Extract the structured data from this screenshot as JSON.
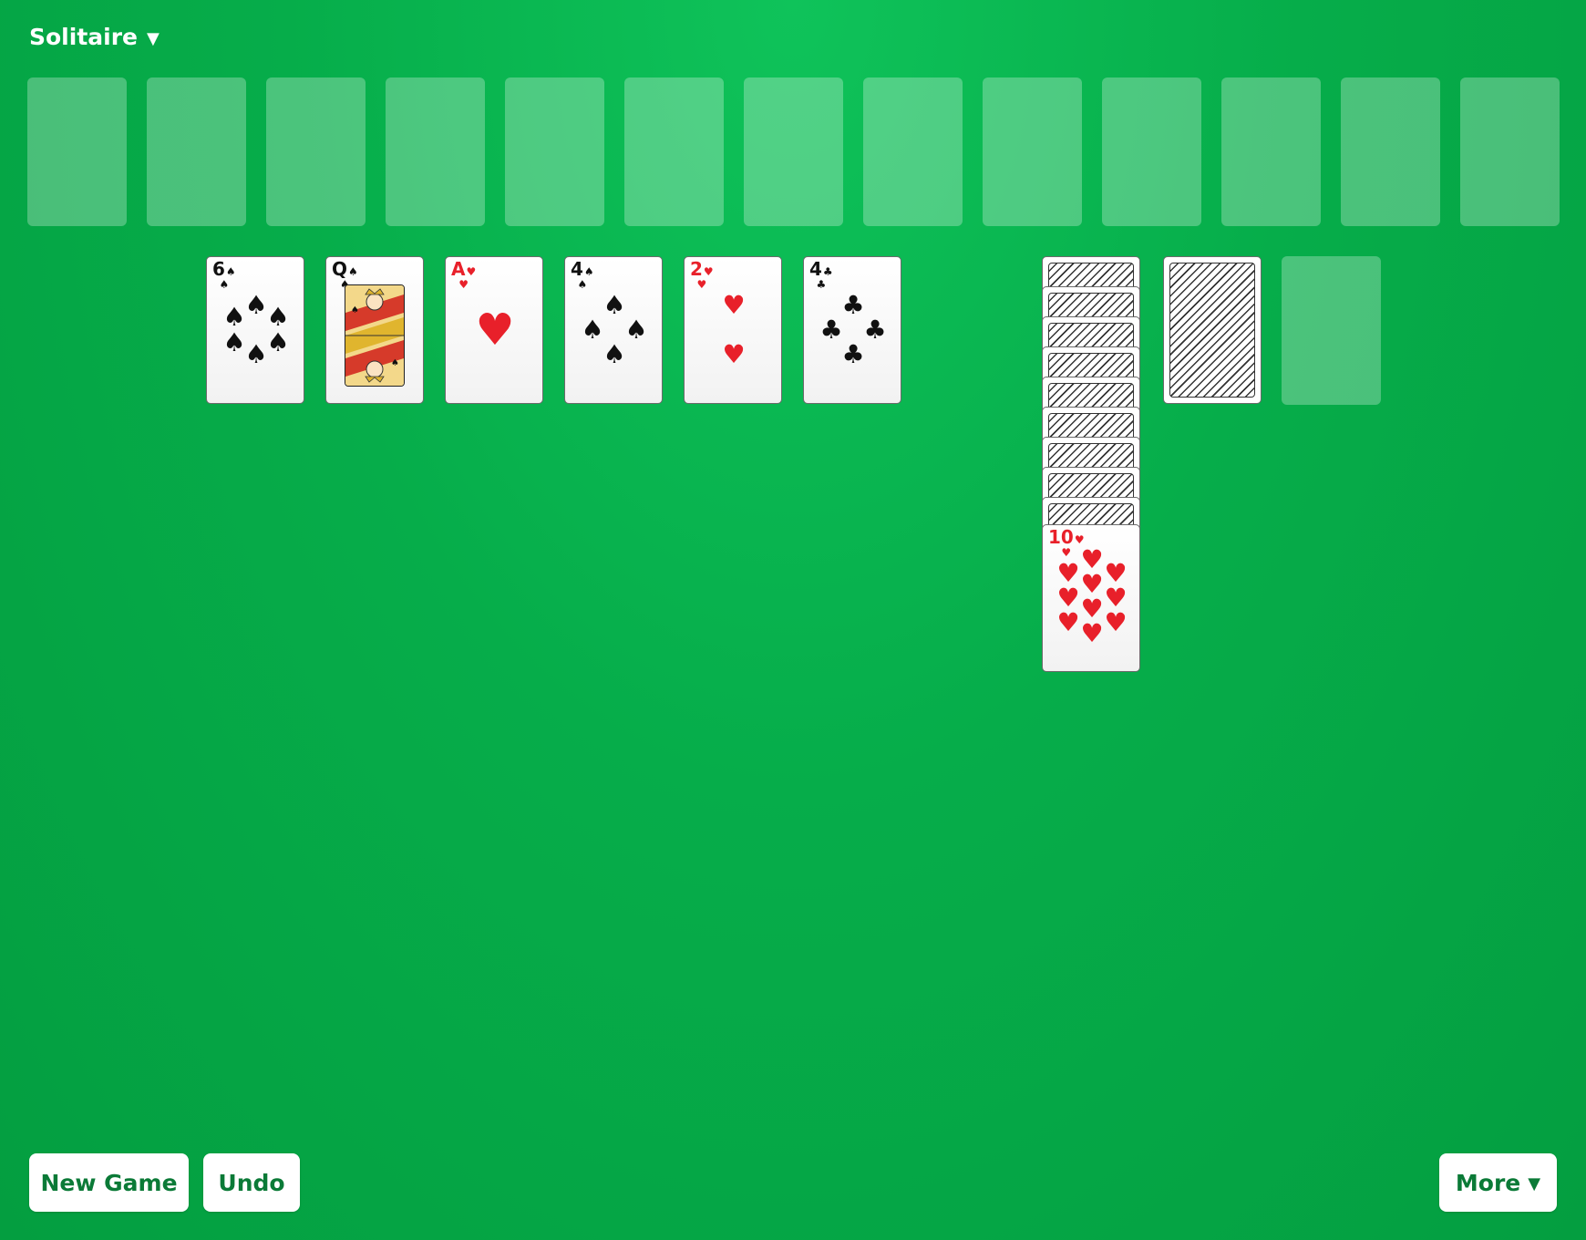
{
  "header": {
    "title": "Solitaire"
  },
  "icons": {
    "dropdown": "caret-down-icon"
  },
  "foundations_count": 13,
  "tableau": [
    {
      "rank": "6",
      "suit": "spades",
      "symbol": "♠",
      "color": "black"
    },
    {
      "rank": "Q",
      "suit": "spades",
      "symbol": "♠",
      "color": "black"
    },
    {
      "rank": "A",
      "suit": "hearts",
      "symbol": "♥",
      "color": "red"
    },
    {
      "rank": "4",
      "suit": "spades",
      "symbol": "♠",
      "color": "black"
    },
    {
      "rank": "2",
      "suit": "hearts",
      "symbol": "♥",
      "color": "red"
    },
    {
      "rank": "4",
      "suit": "clubs",
      "symbol": "♣",
      "color": "black"
    }
  ],
  "pile": {
    "face_down_count": 9,
    "top_card": {
      "rank": "10",
      "suit": "hearts",
      "symbol": "♥",
      "color": "red"
    }
  },
  "stock": {
    "face_down": true
  },
  "waste": {
    "empty": true
  },
  "footer": {
    "new_game_label": "New Game",
    "undo_label": "Undo",
    "more_label": "More"
  },
  "colors": {
    "felt": "#06ad4a",
    "button_text": "#0b7a37",
    "red_suit": "#e8202a",
    "black_suit": "#111111"
  }
}
